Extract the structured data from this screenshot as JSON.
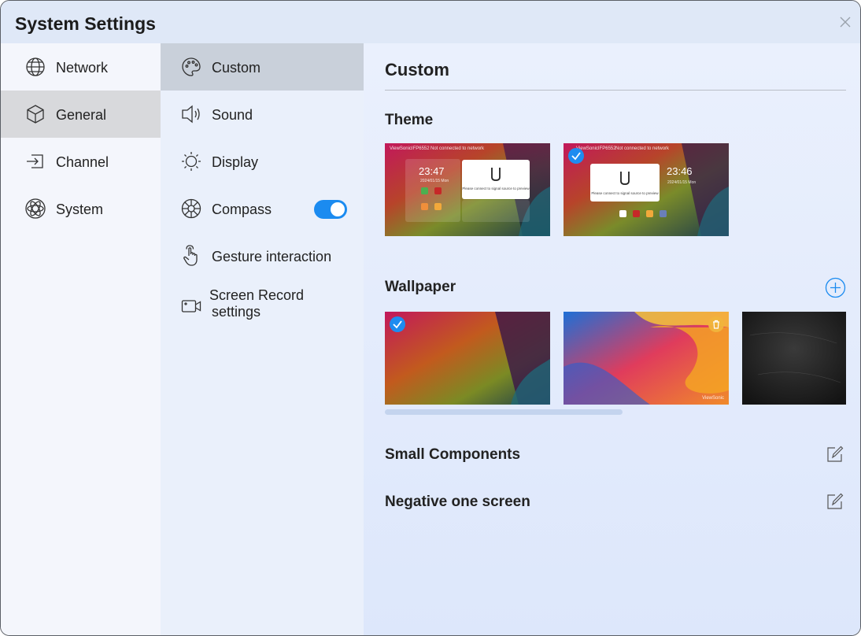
{
  "window": {
    "title": "System Settings"
  },
  "col1": {
    "items": [
      {
        "label": "Network",
        "icon": "globe-icon"
      },
      {
        "label": "General",
        "icon": "cube-icon"
      },
      {
        "label": "Channel",
        "icon": "input-icon"
      },
      {
        "label": "System",
        "icon": "atom-icon"
      }
    ],
    "active_index": 1
  },
  "col2": {
    "items": [
      {
        "label": "Custom",
        "icon": "palette-icon"
      },
      {
        "label": "Sound",
        "icon": "speaker-icon"
      },
      {
        "label": "Display",
        "icon": "sun-icon"
      },
      {
        "label": "Compass",
        "icon": "compass-icon",
        "toggle_on": true
      },
      {
        "label": "Gesture interaction",
        "icon": "hand-icon"
      },
      {
        "label_line1": "Screen Record",
        "label_line2": "settings",
        "icon": "camera-icon"
      }
    ],
    "active_index": 0
  },
  "main": {
    "heading": "Custom",
    "theme": {
      "label": "Theme",
      "previews": [
        {
          "clock": "23:47",
          "date": "2024/01/15 Mon",
          "popup_msg": "Please connect to signal source to preview",
          "selected": false,
          "status_left": "ViewSonicIFP6552",
          "status_right": "Not connected to network"
        },
        {
          "clock": "23:46",
          "date": "2024/01/15 Mon",
          "popup_msg": "Please connect to signal source to preview",
          "selected": true,
          "status_left": "ViewSonicIFP6552",
          "status_right": "Not connected to network"
        }
      ]
    },
    "wallpaper": {
      "label": "Wallpaper",
      "items": [
        {
          "name": "gradient-dark",
          "selected": true
        },
        {
          "name": "gradient-bright",
          "deletable": true,
          "caption": "ViewSonic"
        },
        {
          "name": "chalkboard"
        }
      ]
    },
    "small_components": {
      "label": "Small Components"
    },
    "negative_one_screen": {
      "label": "Negative one screen"
    }
  },
  "colors": {
    "accent": "#1b8bf0",
    "titlebar_bg": "#dfe8f7",
    "col1_active": "#d8d9dc",
    "col2_active": "#c9d0da"
  }
}
